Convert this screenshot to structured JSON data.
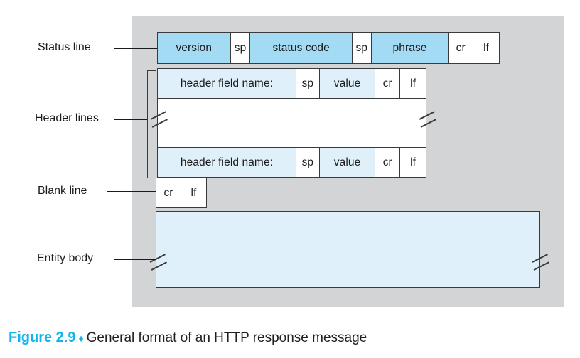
{
  "figure": {
    "panel_bg": "#d2d4d5",
    "accent": "#13b5ea",
    "strong_blue": "#a3dbf5",
    "light_blue": "#e0f0fb",
    "border": "#3a3a3a"
  },
  "annotations": {
    "status_line": "Status line",
    "header_lines": "Header lines",
    "blank_line": "Blank line",
    "entity_body": "Entity body"
  },
  "status_line": {
    "version": "version",
    "sp1": "sp",
    "status_code": "status code",
    "sp2": "sp",
    "phrase": "phrase",
    "cr": "cr",
    "lf": "lf"
  },
  "header_line_1": {
    "field_name": "header field name:",
    "sp": "sp",
    "value": "value",
    "cr": "cr",
    "lf": "lf"
  },
  "header_line_2": {
    "field_name": "header field name:",
    "sp": "sp",
    "value": "value",
    "cr": "cr",
    "lf": "lf"
  },
  "blank_line": {
    "cr": "cr",
    "lf": "lf"
  },
  "entity_body": {
    "content": ""
  },
  "caption": {
    "figure_number": "Figure 2.9",
    "separator": "♦",
    "text": "General format of an HTTP response message"
  }
}
